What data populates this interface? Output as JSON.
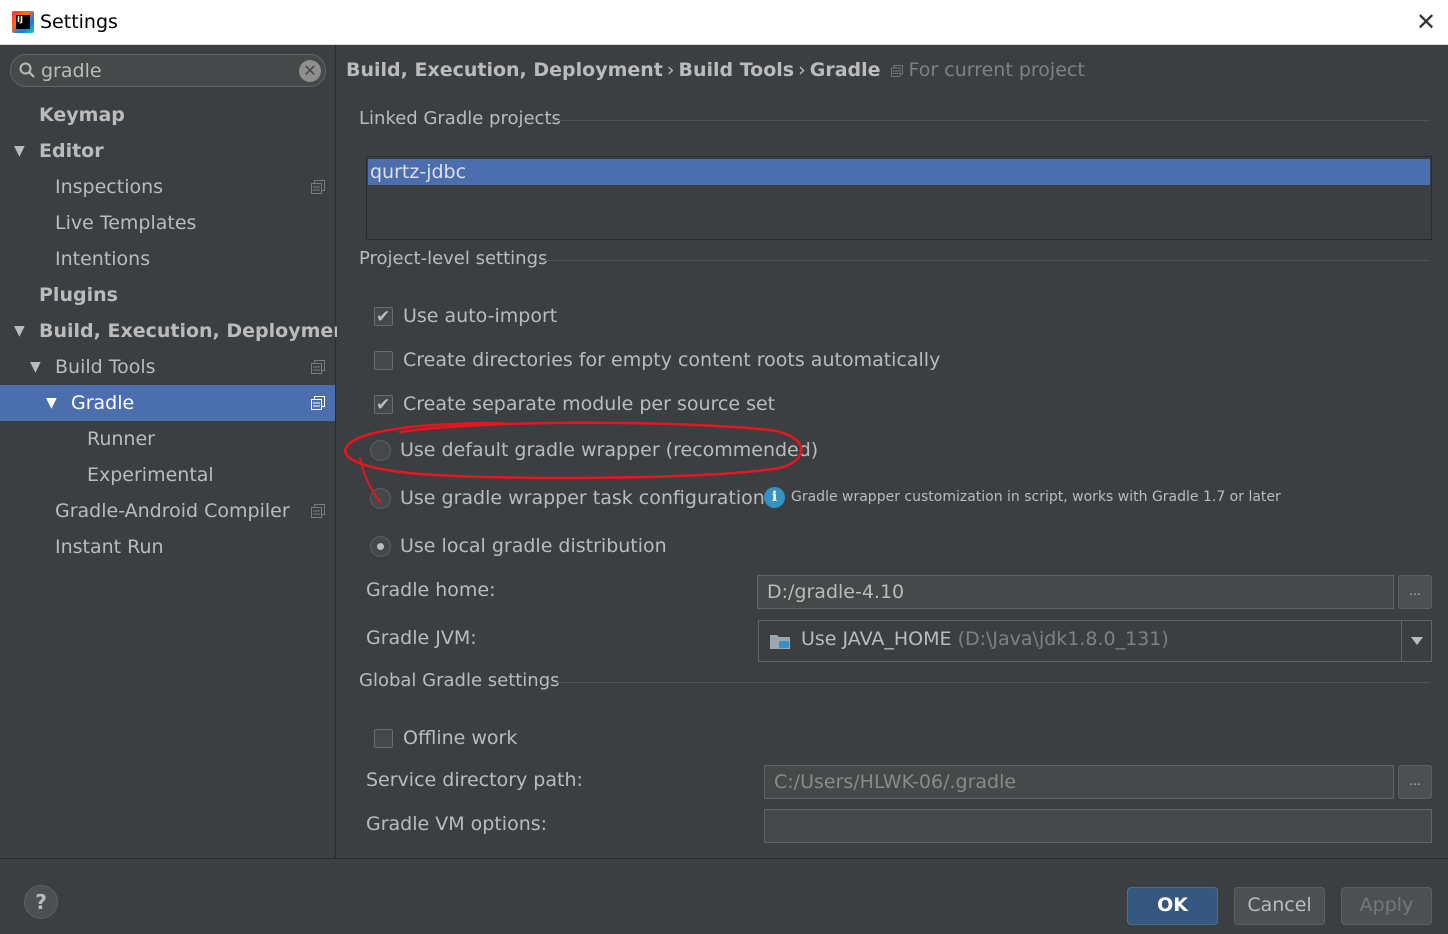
{
  "window": {
    "title": "Settings",
    "close_label": "✕"
  },
  "search": {
    "value": "gradle",
    "clear_label": "✕"
  },
  "sidebar": {
    "items": [
      {
        "label": "Keymap"
      },
      {
        "label": "Editor"
      },
      {
        "label": "Inspections"
      },
      {
        "label": "Live Templates"
      },
      {
        "label": "Intentions"
      },
      {
        "label": "Plugins"
      },
      {
        "label": "Build, Execution, Deployment"
      },
      {
        "label": "Build Tools"
      },
      {
        "label": "Gradle"
      },
      {
        "label": "Runner"
      },
      {
        "label": "Experimental"
      },
      {
        "label": "Gradle-Android Compiler"
      },
      {
        "label": "Instant Run"
      }
    ],
    "selected": "Gradle"
  },
  "breadcrumb": {
    "part1": "Build, Execution, Deployment",
    "part2": "Build Tools",
    "part3": "Gradle",
    "separator": "›",
    "scope": "For current project"
  },
  "linked": {
    "title": "Linked Gradle projects",
    "projects": [
      "qurtz-jdbc"
    ]
  },
  "project_settings": {
    "title": "Project-level settings",
    "auto_import": {
      "label": "Use auto-import",
      "checked": true
    },
    "create_dirs": {
      "label": "Create directories for empty content roots automatically",
      "checked": false
    },
    "separate_module": {
      "label": "Create separate module per source set",
      "checked": true
    },
    "radio_default_wrapper": "Use default gradle wrapper (recommended)",
    "radio_wrapper_task": "Use gradle wrapper task configuration",
    "wrapper_info": "Gradle wrapper customization in script, works with Gradle 1.7 or later",
    "radio_local": "Use local gradle distribution",
    "selected_distribution": "Use local gradle distribution",
    "gradle_home_label": "Gradle home:",
    "gradle_home_value": "D:/gradle-4.10",
    "gradle_jvm_label": "Gradle JVM:",
    "gradle_jvm_value": "Use JAVA_HOME",
    "gradle_jvm_hint": "(D:\\Java\\jdk1.8.0_131)",
    "browse_label": "..."
  },
  "global_settings": {
    "title": "Global Gradle settings",
    "offline": {
      "label": "Offline work",
      "checked": false
    },
    "service_dir_label": "Service directory path:",
    "service_dir_value": "C:/Users/HLWK-06/.gradle",
    "vm_options_label": "Gradle VM options:",
    "vm_options_value": ""
  },
  "footer": {
    "help": "?",
    "ok": "OK",
    "cancel": "Cancel",
    "apply": "Apply"
  },
  "colors": {
    "background": "#3c3f41",
    "selection": "#4b6eaf",
    "ok_button": "#365880",
    "annotation": "#e8141e"
  }
}
